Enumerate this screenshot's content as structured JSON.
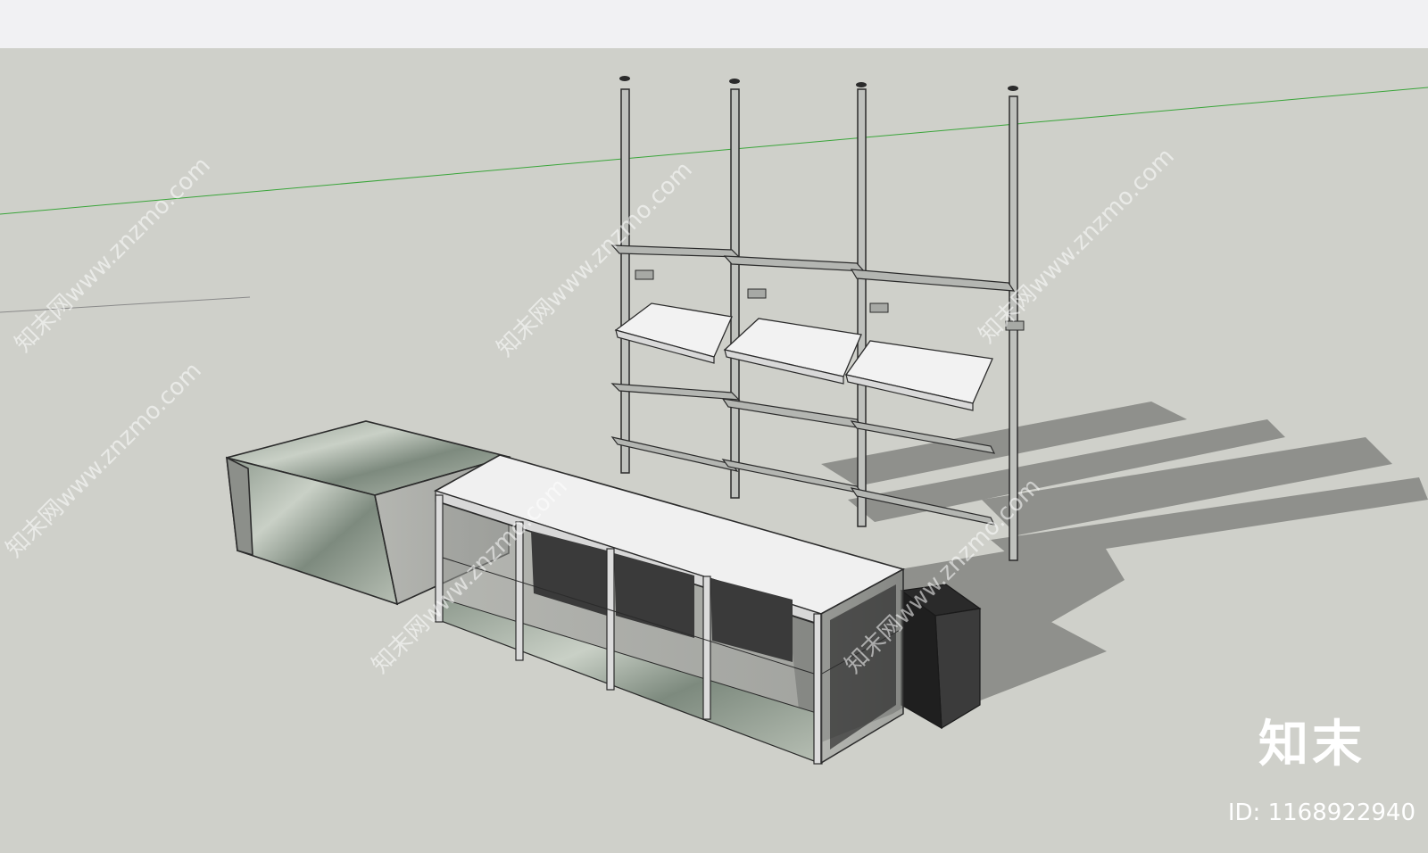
{
  "viewport": {
    "background": "#cfd0ca",
    "toolbar_color": "#f1f1f3"
  },
  "watermark": {
    "text": "知末网www.znzmo.com"
  },
  "brand": {
    "logo_text": "知末",
    "id_label": "ID: 1168922940"
  },
  "scene_objects": [
    "wall-shelving-unit",
    "glass-display-counter",
    "marble-display-box",
    "black-cabinet"
  ]
}
